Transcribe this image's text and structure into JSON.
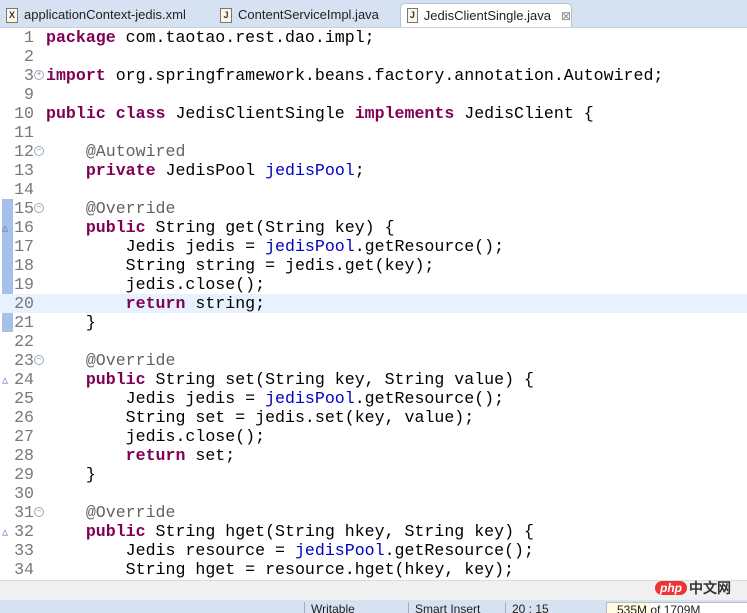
{
  "tabs": [
    {
      "label": "applicationContext-jedis.xml",
      "icon": "xml-file-icon",
      "glyph": "X",
      "active": false
    },
    {
      "label": "ContentServiceImpl.java",
      "icon": "java-file-icon",
      "glyph": "J",
      "active": false
    },
    {
      "label": "JedisClientSingle.java",
      "icon": "java-file-icon",
      "glyph": "J",
      "active": true,
      "close": "⊠"
    }
  ],
  "current_line": 20,
  "lines": [
    {
      "n": "1",
      "t": [
        [
          "package",
          "kw"
        ],
        [
          " com.taotao.rest.dao.impl;",
          ""
        ]
      ]
    },
    {
      "n": "2",
      "t": []
    },
    {
      "n": "3",
      "fold": "+",
      "t": [
        [
          "import",
          "kw"
        ],
        [
          " org.springframework.beans.factory.annotation.Autowired;",
          ""
        ]
      ]
    },
    {
      "n": "9",
      "t": []
    },
    {
      "n": "10",
      "t": [
        [
          "public",
          "kw"
        ],
        [
          " ",
          ""
        ],
        [
          "class",
          "kw"
        ],
        [
          " JedisClientSingle ",
          ""
        ],
        [
          "implements",
          "kw"
        ],
        [
          " JedisClient {",
          ""
        ]
      ]
    },
    {
      "n": "11",
      "t": []
    },
    {
      "n": "12",
      "fold": "-",
      "t": [
        [
          "    ",
          ""
        ],
        [
          "@Autowired",
          "an"
        ]
      ]
    },
    {
      "n": "13",
      "t": [
        [
          "    ",
          ""
        ],
        [
          "private",
          "kw"
        ],
        [
          " JedisPool ",
          ""
        ],
        [
          "jedisPool",
          "fd"
        ],
        [
          ";",
          ""
        ]
      ]
    },
    {
      "n": "14",
      "t": []
    },
    {
      "n": "15",
      "fold": "-",
      "t": [
        [
          "    ",
          ""
        ],
        [
          "@Override",
          "an"
        ]
      ]
    },
    {
      "n": "16",
      "ov": true,
      "t": [
        [
          "    ",
          ""
        ],
        [
          "public",
          "kw"
        ],
        [
          " String get(String key) {",
          ""
        ]
      ]
    },
    {
      "n": "17",
      "t": [
        [
          "        Jedis jedis = ",
          ""
        ],
        [
          "jedisPool",
          "fd"
        ],
        [
          ".getResource();",
          ""
        ]
      ]
    },
    {
      "n": "18",
      "t": [
        [
          "        String string = jedis.get(key);",
          ""
        ]
      ]
    },
    {
      "n": "19",
      "t": [
        [
          "        jedis.close();",
          ""
        ]
      ]
    },
    {
      "n": "20",
      "t": [
        [
          "        ",
          ""
        ],
        [
          "return",
          "kw"
        ],
        [
          " string;",
          ""
        ]
      ]
    },
    {
      "n": "21",
      "t": [
        [
          "    }",
          ""
        ]
      ]
    },
    {
      "n": "22",
      "t": []
    },
    {
      "n": "23",
      "fold": "-",
      "t": [
        [
          "    ",
          ""
        ],
        [
          "@Override",
          "an"
        ]
      ]
    },
    {
      "n": "24",
      "ov": true,
      "t": [
        [
          "    ",
          ""
        ],
        [
          "public",
          "kw"
        ],
        [
          " String set(String key, String value) {",
          ""
        ]
      ]
    },
    {
      "n": "25",
      "t": [
        [
          "        Jedis jedis = ",
          ""
        ],
        [
          "jedisPool",
          "fd"
        ],
        [
          ".getResource();",
          ""
        ]
      ]
    },
    {
      "n": "26",
      "t": [
        [
          "        String set = jedis.set(key, value);",
          ""
        ]
      ]
    },
    {
      "n": "27",
      "t": [
        [
          "        jedis.close();",
          ""
        ]
      ]
    },
    {
      "n": "28",
      "t": [
        [
          "        ",
          ""
        ],
        [
          "return",
          "kw"
        ],
        [
          " set;",
          ""
        ]
      ]
    },
    {
      "n": "29",
      "t": [
        [
          "    }",
          ""
        ]
      ]
    },
    {
      "n": "30",
      "t": []
    },
    {
      "n": "31",
      "fold": "-",
      "t": [
        [
          "    ",
          ""
        ],
        [
          "@Override",
          "an"
        ]
      ]
    },
    {
      "n": "32",
      "ov": true,
      "t": [
        [
          "    ",
          ""
        ],
        [
          "public",
          "kw"
        ],
        [
          " String hget(String hkey, String key) {",
          ""
        ]
      ]
    },
    {
      "n": "33",
      "t": [
        [
          "        Jedis resource = ",
          ""
        ],
        [
          "jedisPool",
          "fd"
        ],
        [
          ".getResource();",
          ""
        ]
      ]
    },
    {
      "n": "34",
      "t": [
        [
          "        String hget = resource.hget(hkey, key);",
          ""
        ]
      ]
    }
  ],
  "status": {
    "writable": "Writable",
    "insert_mode": "Smart Insert",
    "position": "20 : 15",
    "memory": "535M of 1709M",
    "memory_fraction": 0.31
  },
  "watermark": {
    "php": "php",
    "text": "中文网"
  }
}
